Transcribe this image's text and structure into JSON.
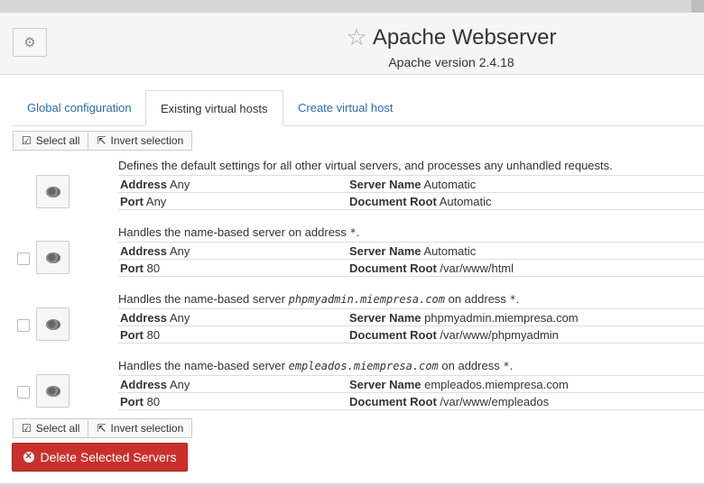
{
  "header": {
    "title": "Apache Webserver",
    "subtitle": "Apache version 2.4.18"
  },
  "tabs": [
    {
      "label": "Global configuration",
      "active": false
    },
    {
      "label": "Existing virtual hosts",
      "active": true
    },
    {
      "label": "Create virtual host",
      "active": false
    }
  ],
  "selection": {
    "select_all": "Select all",
    "invert": "Invert selection"
  },
  "labels": {
    "address": "Address",
    "port": "Port",
    "server_name": "Server Name",
    "document_root": "Document Root"
  },
  "hosts": [
    {
      "desc": "Defines the default settings for all other virtual servers, and processes any unhandled requests.",
      "address": "Any",
      "port": "Any",
      "server_name": "Automatic",
      "document_root": "Automatic",
      "has_checkbox": false
    },
    {
      "desc_prefix": "Handles the name-based server ",
      "desc_server": "",
      "desc_mid": " on address ",
      "desc_addr": "*",
      "desc_suffix": ".",
      "address": "Any",
      "port": "80",
      "server_name": "Automatic",
      "document_root": "/var/www/html",
      "has_checkbox": true
    },
    {
      "desc_prefix": "Handles the name-based server ",
      "desc_server": "phpmyadmin.miempresa.com",
      "desc_mid": " on address ",
      "desc_addr": "*",
      "desc_suffix": ".",
      "address": "Any",
      "port": "80",
      "server_name": "phpmyadmin.miempresa.com",
      "document_root": "/var/www/phpmyadmin",
      "has_checkbox": true
    },
    {
      "desc_prefix": "Handles the name-based server ",
      "desc_server": "empleados.miempresa.com",
      "desc_mid": " on address ",
      "desc_addr": "*",
      "desc_suffix": ".",
      "address": "Any",
      "port": "80",
      "server_name": "empleados.miempresa.com",
      "document_root": "/var/www/empleados",
      "has_checkbox": true
    }
  ],
  "delete_button": "Delete Selected Servers",
  "colors": {
    "link": "#2b6cb0",
    "danger": "#c9302c"
  }
}
